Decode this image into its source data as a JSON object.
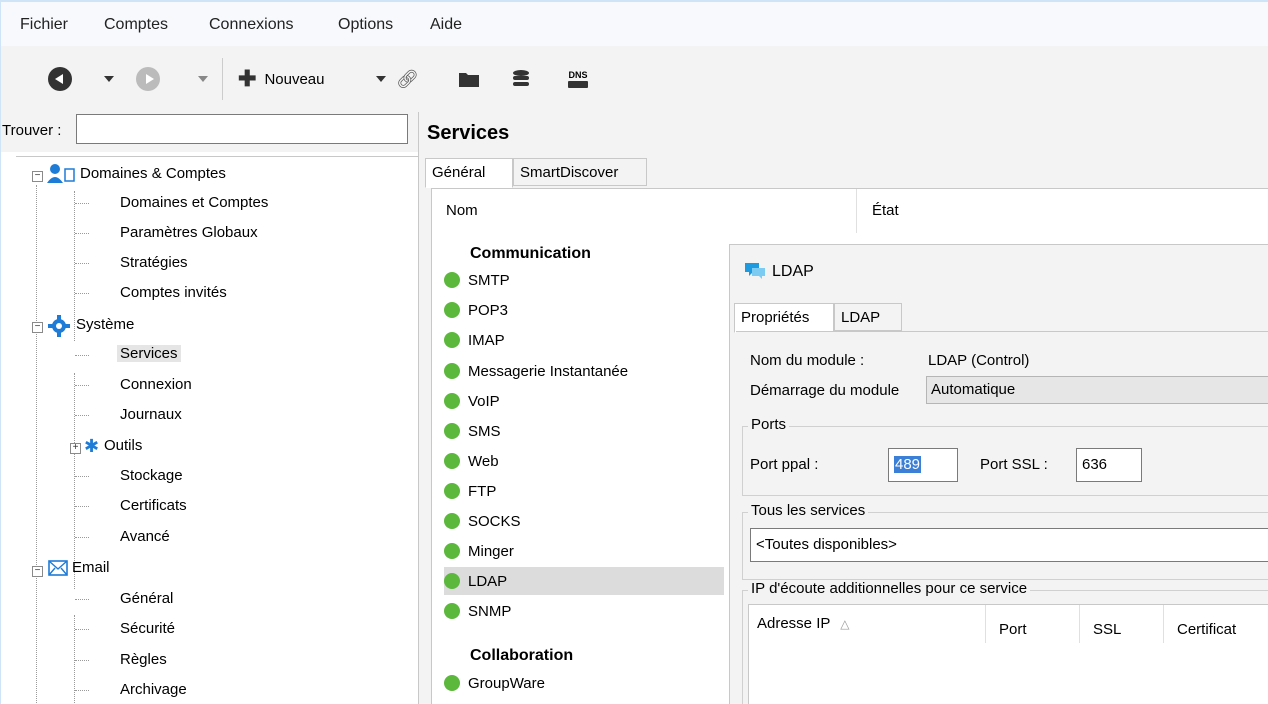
{
  "menu": [
    "Fichier",
    "Comptes",
    "Connexions",
    "Options",
    "Aide"
  ],
  "toolbar": {
    "new_label": "Nouveau",
    "dns_label": "DNS"
  },
  "left": {
    "find_label": "Trouver :",
    "find_value": "",
    "tree": {
      "domains": "Domaines & Comptes",
      "domains_children": [
        "Domaines et Comptes",
        "Paramètres Globaux",
        "Stratégies",
        "Comptes invités"
      ],
      "system": "Système",
      "system_children": [
        "Services",
        "Connexion",
        "Journaux"
      ],
      "tools": "Outils",
      "system_children2": [
        "Stockage",
        "Certificats",
        "Avancé"
      ],
      "email": "Email",
      "email_children": [
        "Général",
        "Sécurité",
        "Règles",
        "Archivage"
      ]
    }
  },
  "main": {
    "title": "Services",
    "tabs": [
      "Général",
      "SmartDiscover"
    ],
    "columns": [
      "Nom",
      "État"
    ],
    "group1": "Communication",
    "services": [
      "SMTP",
      "POP3",
      "IMAP",
      "Messagerie Instantanée",
      "VoIP",
      "SMS",
      "Web",
      "FTP",
      "SOCKS",
      "Minger",
      "LDAP",
      "SNMP"
    ],
    "group2": "Collaboration",
    "services2": [
      "GroupWare"
    ],
    "status_color": "#5cb83c"
  },
  "dialog": {
    "title": "LDAP",
    "tabs": [
      "Propriétés",
      "LDAP"
    ],
    "module_name_label": "Nom du module :",
    "module_name_value": "LDAP (Control)",
    "startup_label": "Démarrage du module",
    "startup_value": "Automatique",
    "ports_legend": "Ports",
    "port_main_label": "Port ppal :",
    "port_main_value": "489",
    "port_ssl_label": "Port SSL :",
    "port_ssl_value": "636",
    "all_services_legend": "Tous les services",
    "all_services_value": "<Toutes disponibles>",
    "ip_legend": "IP d'écoute additionnelles pour ce service",
    "ip_columns": [
      "Adresse IP",
      "Port",
      "SSL",
      "Certificat"
    ],
    "sort_indicator": "△"
  }
}
